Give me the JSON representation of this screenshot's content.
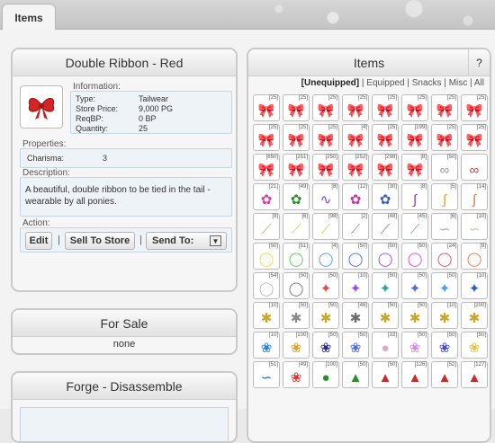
{
  "tabs": [
    {
      "label": "Items"
    }
  ],
  "detail": {
    "title": "Double Ribbon - Red",
    "item_color": "#d42424",
    "info_legend": "Information:",
    "info": [
      {
        "key": "Type:",
        "value": "Tailwear"
      },
      {
        "key": "Store Price:",
        "value": "9,000 PG"
      },
      {
        "key": "ReqBP:",
        "value": "0 BP"
      },
      {
        "key": "Quantity:",
        "value": "25"
      }
    ],
    "properties_legend": "Properties:",
    "properties": [
      {
        "key": "Charisma:",
        "value": "3"
      }
    ],
    "description_legend": "Description:",
    "description": "A beautiful, double ribbon to be tied in the tail - wearable by all ponies.",
    "action_legend": "Action:",
    "actions": {
      "edit": "Edit",
      "sell": "Sell To Store",
      "send_to": "Send To:",
      "sep": "|"
    }
  },
  "for_sale": {
    "title": "For Sale",
    "value": "none"
  },
  "forge": {
    "title": "Forge - Disassemble"
  },
  "items": {
    "title": "Items",
    "help": "?",
    "filters": [
      {
        "label": "[Unequipped]",
        "active": true
      },
      {
        "label": "|",
        "active": false
      },
      {
        "label": "Equipped",
        "active": false
      },
      {
        "label": "|",
        "active": false
      },
      {
        "label": "Snacks",
        "active": false
      },
      {
        "label": "|",
        "active": false
      },
      {
        "label": "Misc",
        "active": false
      },
      {
        "label": "|",
        "active": false
      },
      {
        "label": "All",
        "active": false
      }
    ],
    "grid": [
      {
        "count": "[25]",
        "glyph": "🎀",
        "color": "#d42424"
      },
      {
        "count": "[25]",
        "glyph": "🎀",
        "color": "#222222"
      },
      {
        "count": "[25]",
        "glyph": "🎀",
        "color": "#e02d2d"
      },
      {
        "count": "[25]",
        "glyph": "🎀",
        "color": "#e8c21a"
      },
      {
        "count": "[25]",
        "glyph": "🎀",
        "color": "#2aa52a"
      },
      {
        "count": "[25]",
        "glyph": "🎀",
        "color": "#25b4c8"
      },
      {
        "count": "[25]",
        "glyph": "🎀",
        "color": "#2c3ec9"
      },
      {
        "count": "[25]",
        "glyph": "🎀",
        "color": "#2c3ec9"
      },
      {
        "count": "[25]",
        "glyph": "🎀",
        "color": "#8b2ec4"
      },
      {
        "count": "[25]",
        "glyph": "🎀",
        "color": "#e54fa6"
      },
      {
        "count": "[25]",
        "glyph": "🎀",
        "color": "#888888"
      },
      {
        "count": "[4]",
        "glyph": "🎀",
        "color": "#e11f1f"
      },
      {
        "count": "[25]",
        "glyph": "🎀",
        "color": "#a0521a"
      },
      {
        "count": "[199]",
        "glyph": "🎀",
        "color": "#e02a2a"
      },
      {
        "count": "[25]",
        "glyph": "🎀",
        "color": "#e8356d"
      },
      {
        "count": "[25]",
        "glyph": "🎀",
        "color": "#d4a017"
      },
      {
        "count": "[650]",
        "glyph": "🎀",
        "color": "#e6d21a"
      },
      {
        "count": "[251]",
        "glyph": "🎀",
        "color": "#2ab3d6"
      },
      {
        "count": "[250]",
        "glyph": "🎀",
        "color": "#2a7cd6"
      },
      {
        "count": "[253]",
        "glyph": "🎀",
        "color": "#6a3ec9"
      },
      {
        "count": "[298]",
        "glyph": "🎀",
        "color": "#8a3ec9"
      },
      {
        "count": "[8]",
        "glyph": "🎀",
        "color": "#c93ec0"
      },
      {
        "count": "[50]",
        "glyph": "∞",
        "color": "#9a9a9a"
      },
      {
        "count": "",
        "glyph": "∞",
        "color": "#c44444"
      },
      {
        "count": "[21]",
        "glyph": "✿",
        "color": "#e03a9e"
      },
      {
        "count": "[49]",
        "glyph": "✿",
        "color": "#2a8f2a"
      },
      {
        "count": "[8]",
        "glyph": "∿",
        "color": "#7a3ec9"
      },
      {
        "count": "[12]",
        "glyph": "✿",
        "color": "#c9339e"
      },
      {
        "count": "[30]",
        "glyph": "✿",
        "color": "#3a5ec9"
      },
      {
        "count": "[8]",
        "glyph": "∫",
        "color": "#7a3ec9"
      },
      {
        "count": "[5]",
        "glyph": "∫",
        "color": "#e0a12a"
      },
      {
        "count": "[14]",
        "glyph": "∫",
        "color": "#e07a2a"
      },
      {
        "count": "[9]",
        "glyph": "⟋",
        "color": "#e8a44c"
      },
      {
        "count": "[6]",
        "glyph": "⟋",
        "color": "#e8d24c"
      },
      {
        "count": "[98]",
        "glyph": "⟋",
        "color": "#e8c14c"
      },
      {
        "count": "[2]",
        "glyph": "⟋",
        "color": "#b16ee0"
      },
      {
        "count": "[48]",
        "glyph": "⟋",
        "color": "#8c6ee0"
      },
      {
        "count": "[45]",
        "glyph": "⟋",
        "color": "#c76ee0"
      },
      {
        "count": "[6]",
        "glyph": "∽",
        "color": "#ee8c8c"
      },
      {
        "count": "[10]",
        "glyph": "∽",
        "color": "#eeb48c"
      },
      {
        "count": "[50]",
        "glyph": "◯",
        "color": "#e8e04c"
      },
      {
        "count": "[51]",
        "glyph": "◯",
        "color": "#5ac95a"
      },
      {
        "count": "[4]",
        "glyph": "◯",
        "color": "#4ca0e8"
      },
      {
        "count": "[50]",
        "glyph": "◯",
        "color": "#4c6ce8"
      },
      {
        "count": "[50]",
        "glyph": "◯",
        "color": "#9c4ce8"
      },
      {
        "count": "[50]",
        "glyph": "◯",
        "color": "#e84cb0"
      },
      {
        "count": "[24]",
        "glyph": "◯",
        "color": "#e84c6c"
      },
      {
        "count": "[9]",
        "glyph": "◯",
        "color": "#e87a4c"
      },
      {
        "count": "[54]",
        "glyph": "◯",
        "color": "#bbbbbb"
      },
      {
        "count": "[50]",
        "glyph": "◯",
        "color": "#777777"
      },
      {
        "count": "[50]",
        "glyph": "✦",
        "color": "#e04c4c"
      },
      {
        "count": "[10]",
        "glyph": "✦",
        "color": "#9c4ce8"
      },
      {
        "count": "[50]",
        "glyph": "✦",
        "color": "#2aa5a0"
      },
      {
        "count": "[50]",
        "glyph": "✦",
        "color": "#4c6ce8"
      },
      {
        "count": "[50]",
        "glyph": "✦",
        "color": "#4ca0e8"
      },
      {
        "count": "[10]",
        "glyph": "✦",
        "color": "#2a5ec9"
      },
      {
        "count": "[10]",
        "glyph": "✱",
        "color": "#c9a62a"
      },
      {
        "count": "[50]",
        "glyph": "✱",
        "color": "#8a8a8a"
      },
      {
        "count": "[50]",
        "glyph": "✱",
        "color": "#c9a62a"
      },
      {
        "count": "[48]",
        "glyph": "✱",
        "color": "#6a6a6a"
      },
      {
        "count": "[50]",
        "glyph": "✱",
        "color": "#c9a62a"
      },
      {
        "count": "[50]",
        "glyph": "✱",
        "color": "#c9a62a"
      },
      {
        "count": "[10]",
        "glyph": "✱",
        "color": "#c9a62a"
      },
      {
        "count": "[200]",
        "glyph": "✱",
        "color": "#c9a62a"
      },
      {
        "count": "[10]",
        "glyph": "❀",
        "color": "#2a7ce0"
      },
      {
        "count": "[100]",
        "glyph": "❀",
        "color": "#e0a12a"
      },
      {
        "count": "[50]",
        "glyph": "❀",
        "color": "#2a2a8a"
      },
      {
        "count": "[50]",
        "glyph": "❀",
        "color": "#4c6ce8"
      },
      {
        "count": "[33]",
        "glyph": "●",
        "color": "#e8a0d0"
      },
      {
        "count": "[50]",
        "glyph": "❀",
        "color": "#d08ae0"
      },
      {
        "count": "[50]",
        "glyph": "❀",
        "color": "#4c4cc9"
      },
      {
        "count": "[50]",
        "glyph": "❀",
        "color": "#e0c84c"
      },
      {
        "count": "[51]",
        "glyph": "∽",
        "color": "#2a5ec9"
      },
      {
        "count": "[49]",
        "glyph": "❀",
        "color": "#e03030"
      },
      {
        "count": "[100]",
        "glyph": "●",
        "color": "#2a8f2a"
      },
      {
        "count": "[50]",
        "glyph": "▲",
        "color": "#2a8f2a"
      },
      {
        "count": "[50]",
        "glyph": "▲",
        "color": "#c92a2a"
      },
      {
        "count": "[126]",
        "glyph": "▲",
        "color": "#c92a2a"
      },
      {
        "count": "[52]",
        "glyph": "▲",
        "color": "#c92a2a"
      },
      {
        "count": "[127]",
        "glyph": "▲",
        "color": "#c92a2a"
      }
    ]
  }
}
